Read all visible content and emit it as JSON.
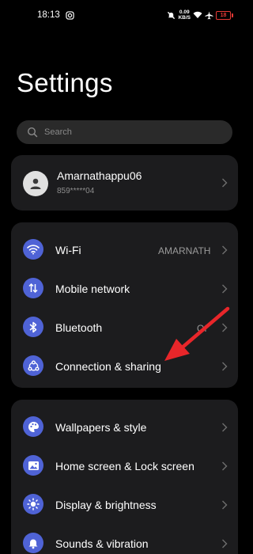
{
  "status_bar": {
    "time": "18:13",
    "net_speed_value": "0.09",
    "net_speed_unit": "KB/S",
    "battery": "18"
  },
  "page_title": "Settings",
  "search": {
    "placeholder": "Search"
  },
  "profile": {
    "name": "Amarnathappu06",
    "phone": "859*****04"
  },
  "group_1": [
    {
      "label": "Wi-Fi",
      "value": "AMARNATH",
      "icon": "wifi-icon"
    },
    {
      "label": "Mobile network",
      "value": "",
      "icon": "mobile-network-icon"
    },
    {
      "label": "Bluetooth",
      "value": "Of",
      "icon": "bluetooth-icon"
    },
    {
      "label": "Connection & sharing",
      "value": "",
      "icon": "connection-sharing-icon"
    }
  ],
  "group_2": [
    {
      "label": "Wallpapers & style",
      "icon": "palette-icon"
    },
    {
      "label": "Home screen & Lock screen",
      "icon": "image-icon"
    },
    {
      "label": "Display & brightness",
      "icon": "brightness-icon"
    },
    {
      "label": "Sounds & vibration",
      "icon": "bell-icon"
    }
  ],
  "colors": {
    "background": "#000000",
    "card": "#1c1c1e",
    "icon_accent": "#4f63d6",
    "annotation": "#e8262a",
    "battery_low": "#e53935"
  }
}
